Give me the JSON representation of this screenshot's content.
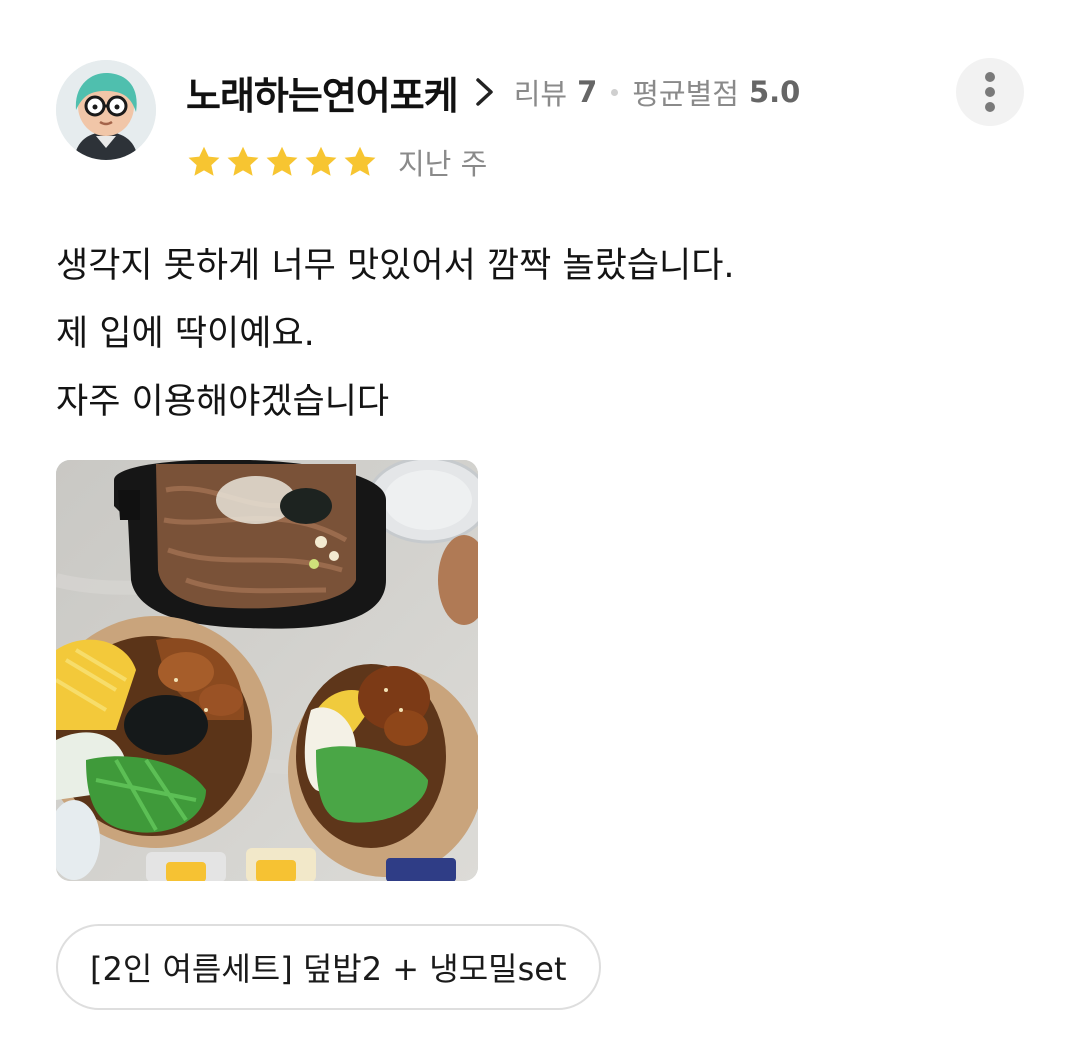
{
  "review": {
    "author_name": "노래하는연어포케",
    "review_label": "리뷰",
    "review_count": "7",
    "avg_label": "평균별점",
    "avg_score": "5.0",
    "rating": 5,
    "date": "지난 주",
    "body_lines": [
      "생각지 못하게 너무 맛있어서 깜짝 놀랐습니다.",
      "제 입에 딱이예요.",
      "자주 이용해야겠습니다"
    ],
    "menu_tag": "[2인 여름세트] 덮밥2 + 냉모밀set"
  },
  "colors": {
    "star": "#f7c531",
    "meta_gray": "#8a8a8a",
    "chip_border": "#dedede"
  },
  "icons": [
    "chevron-right-icon",
    "more-vertical-icon",
    "star-icon"
  ]
}
